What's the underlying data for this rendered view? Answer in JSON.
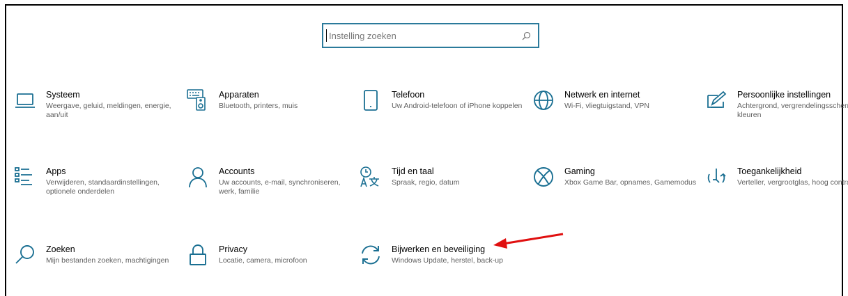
{
  "search": {
    "placeholder": "Instelling zoeken",
    "value": ""
  },
  "accent": "#1a6f92",
  "tiles": [
    {
      "title": "Systeem",
      "desc": "Weergave, geluid, meldingen, energie, aan/uit",
      "icon": "laptop-icon"
    },
    {
      "title": "Apparaten",
      "desc": "Bluetooth, printers, muis",
      "icon": "devices-icon"
    },
    {
      "title": "Telefoon",
      "desc": "Uw Android-telefoon of iPhone koppelen",
      "icon": "phone-icon"
    },
    {
      "title": "Netwerk en internet",
      "desc": "Wi-Fi, vliegtuigstand, VPN",
      "icon": "globe-icon"
    },
    {
      "title": "Persoonlijke instellingen",
      "desc": "Achtergrond, vergrendelingsscherm, kleuren",
      "icon": "personalization-icon"
    },
    {
      "title": "Apps",
      "desc": "Verwijderen, standaardinstellingen, optionele onderdelen",
      "icon": "apps-list-icon"
    },
    {
      "title": "Accounts",
      "desc": "Uw accounts, e-mail, synchroniseren, werk, familie",
      "icon": "person-icon"
    },
    {
      "title": "Tijd en taal",
      "desc": "Spraak, regio, datum",
      "icon": "time-language-icon"
    },
    {
      "title": "Gaming",
      "desc": "Xbox Game Bar, opnames, Gamemodus",
      "icon": "xbox-icon"
    },
    {
      "title": "Toegankelijkheid",
      "desc": "Verteller, vergrootglas, hoog contrast",
      "icon": "accessibility-icon"
    },
    {
      "title": "Zoeken",
      "desc": "Mijn bestanden zoeken, machtigingen",
      "icon": "search-icon"
    },
    {
      "title": "Privacy",
      "desc": "Locatie, camera, microfoon",
      "icon": "lock-icon"
    },
    {
      "title": "Bijwerken en beveiliging",
      "desc": "Windows Update, herstel, back-up",
      "icon": "update-sync-icon"
    }
  ],
  "annotation": {
    "color": "#e01010",
    "icon": "red-arrow-icon"
  }
}
